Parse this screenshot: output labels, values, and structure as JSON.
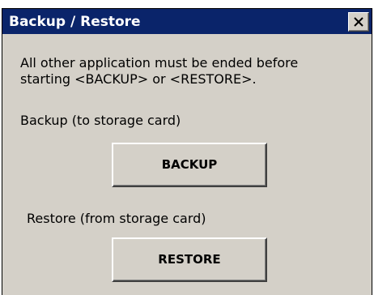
{
  "window": {
    "title": "Backup / Restore",
    "close_icon": "close-icon"
  },
  "content": {
    "message_line1": "All other application must be ended before",
    "message_line2": "starting <BACKUP> or <RESTORE>.",
    "backup_label": "Backup (to storage card)",
    "backup_button": "BACKUP",
    "restore_label": "Restore (from storage card)",
    "restore_button": "RESTORE"
  },
  "colors": {
    "titlebar": "#0a246a",
    "dialog_bg": "#d4d0c8"
  }
}
